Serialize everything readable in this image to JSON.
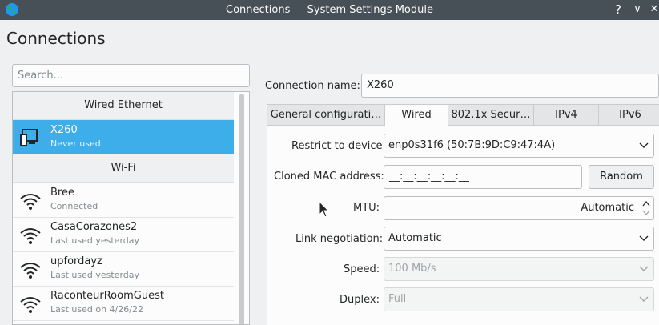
{
  "window": {
    "title": "Connections — System Settings Module",
    "help_symbol": "?",
    "minimize_symbol": "∨",
    "close_symbol": "✕"
  },
  "page": {
    "title": "Connections"
  },
  "search": {
    "placeholder": "Search..."
  },
  "connections": {
    "wired_header": "Wired Ethernet",
    "wifi_header": "Wi-Fi",
    "wired": [
      {
        "name": "X260",
        "status": "Never used",
        "icon": "computer-icon",
        "selected": true
      }
    ],
    "wifi": [
      {
        "name": "Bree",
        "status": "Connected",
        "icon": "wifi-icon"
      },
      {
        "name": "CasaCorazones2",
        "status": "Last used yesterday",
        "icon": "wifi-icon"
      },
      {
        "name": "upfordayz",
        "status": "Last used yesterday",
        "icon": "wifi-icon"
      },
      {
        "name": "RaconteurRoomGuest",
        "status": "Last used on 4/26/22",
        "icon": "wifi-icon"
      }
    ]
  },
  "detail": {
    "connection_name_label": "Connection name:",
    "connection_name_value": "X260",
    "tabs": [
      {
        "label": "General configurati…",
        "active": false
      },
      {
        "label": "Wired",
        "active": true
      },
      {
        "label": "802.1x Secur…",
        "active": false
      },
      {
        "label": "IPv4",
        "active": false
      },
      {
        "label": "IPv6",
        "active": false
      }
    ],
    "restrict_label": "Restrict to device:",
    "restrict_value": "enp0s31f6 (50:7B:9D:C9:47:4A)",
    "cloned_mac_label": "Cloned MAC address:",
    "cloned_mac_value": "__:__:__:__:__:__",
    "random_button": "Random",
    "mtu_label": "MTU:",
    "mtu_value": "Automatic",
    "link_label": "Link negotiation:",
    "link_value": "Automatic",
    "speed_label": "Speed:",
    "speed_value": "100 Mb/s",
    "duplex_label": "Duplex:",
    "duplex_value": "Full"
  },
  "colors": {
    "titlebar": "#475057",
    "selection": "#3daee9",
    "background": "#eff0f1"
  }
}
